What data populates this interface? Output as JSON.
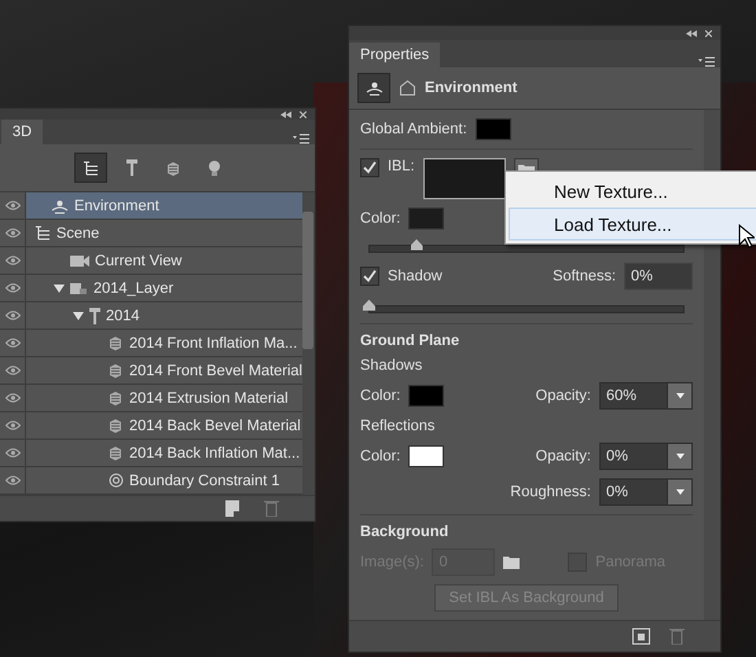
{
  "panel_3d": {
    "title": "3D",
    "filter_tabs": [
      {
        "kind": "scene",
        "selected": true
      },
      {
        "kind": "mesh",
        "selected": false
      },
      {
        "kind": "material",
        "selected": false
      },
      {
        "kind": "light",
        "selected": false
      }
    ],
    "tree": [
      {
        "kind": "environment",
        "label": "Environment",
        "selected": true
      },
      {
        "kind": "scene",
        "label": "Scene",
        "selected": false,
        "children": [
          {
            "kind": "camera",
            "label": "Current View",
            "selected": false
          },
          {
            "kind": "layer",
            "label": "2014_Layer",
            "selected": false,
            "expanded": true,
            "children": [
              {
                "kind": "mesh",
                "label": "2014",
                "selected": false,
                "expanded": true,
                "children": [
                  {
                    "kind": "material",
                    "label": "2014 Front Inflation Ma...",
                    "selected": false
                  },
                  {
                    "kind": "material",
                    "label": "2014 Front Bevel Material",
                    "selected": false
                  },
                  {
                    "kind": "material",
                    "label": "2014 Extrusion Material",
                    "selected": false
                  },
                  {
                    "kind": "material",
                    "label": "2014 Back Bevel Material",
                    "selected": false
                  },
                  {
                    "kind": "material",
                    "label": "2014 Back Inflation Mat...",
                    "selected": false
                  },
                  {
                    "kind": "constraint",
                    "label": "Boundary Constraint 1",
                    "selected": false
                  }
                ]
              }
            ]
          }
        ]
      }
    ]
  },
  "properties": {
    "title": "Properties",
    "header": "Environment",
    "global_ambient": {
      "label": "Global Ambient:",
      "color": "#000000"
    },
    "ibl": {
      "label": "IBL:",
      "checked": true,
      "color_label": "Color:",
      "color": "#1c1c1c",
      "level": 0.15
    },
    "texture_menu": [
      {
        "label": "New Texture...",
        "selected": false
      },
      {
        "label": "Load Texture...",
        "selected": true
      }
    ],
    "shadow": {
      "label": "Shadow",
      "checked": true,
      "softness_label": "Softness:",
      "softness": "0%",
      "level": 0
    },
    "ground_plane": {
      "heading": "Ground Plane",
      "shadows": {
        "heading": "Shadows",
        "color_label": "Color:",
        "color": "#000000",
        "opacity_label": "Opacity:",
        "opacity": "60%"
      },
      "reflections": {
        "heading": "Reflections",
        "color_label": "Color:",
        "color": "#ffffff",
        "opacity_label": "Opacity:",
        "opacity": "0%",
        "roughness_label": "Roughness:",
        "roughness": "0%"
      }
    },
    "background": {
      "heading": "Background",
      "images_label": "Image(s):",
      "images": "0",
      "disabled": true,
      "panorama_label": "Panorama",
      "panorama_checked": false,
      "button": "Set IBL As Background"
    }
  }
}
